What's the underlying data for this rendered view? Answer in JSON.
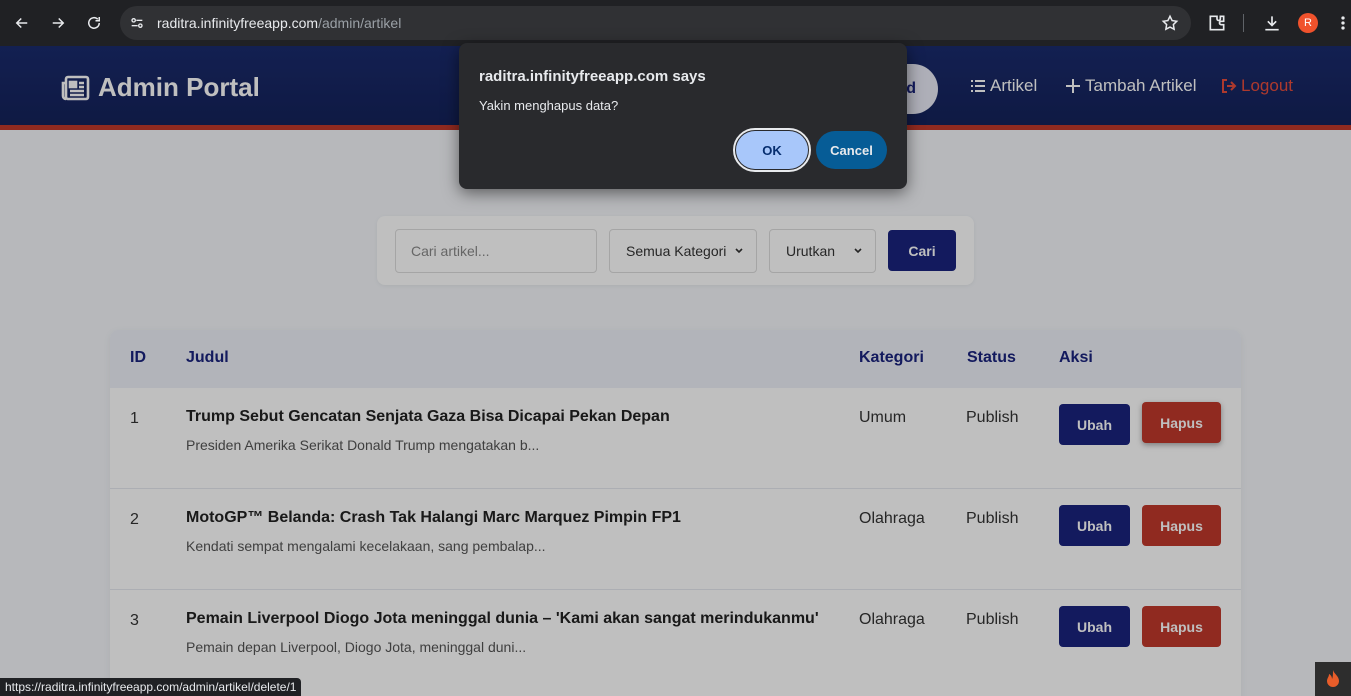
{
  "browser": {
    "url_host": "raditra.infinityfreeapp.com",
    "url_path": "/admin/artikel",
    "profile_initial": "R",
    "status_url": "https://raditra.infinityfreeapp.com/admin/artikel/delete/1"
  },
  "navbar": {
    "brand": "Admin Portal",
    "dashboard_partial": "d",
    "links": {
      "artikel": "Artikel",
      "tambah": "Tambah Artikel",
      "logout": "Logout"
    }
  },
  "search": {
    "placeholder": "Cari artikel...",
    "category_select": "Semua Kategori",
    "sort_select": "Urutkan",
    "button": "Cari"
  },
  "table": {
    "headers": {
      "id": "ID",
      "judul": "Judul",
      "kategori": "Kategori",
      "status": "Status",
      "aksi": "Aksi"
    },
    "edit_label": "Ubah",
    "delete_label": "Hapus",
    "rows": [
      {
        "id": "1",
        "title": "Trump Sebut Gencatan Senjata Gaza Bisa Dicapai Pekan Depan",
        "excerpt": "Presiden Amerika Serikat Donald Trump mengatakan b...",
        "category": "Umum",
        "status": "Publish"
      },
      {
        "id": "2",
        "title": "MotoGP™ Belanda: Crash Tak Halangi Marc Marquez Pimpin FP1",
        "excerpt": "Kendati sempat mengalami kecelakaan, sang pembalap...",
        "category": "Olahraga",
        "status": "Publish"
      },
      {
        "id": "3",
        "title": "Pemain Liverpool Diogo Jota meninggal dunia – 'Kami akan sangat merindukanmu'",
        "excerpt": "Pemain depan Liverpool, Diogo Jota, meninggal duni...",
        "category": "Olahraga",
        "status": "Publish"
      }
    ]
  },
  "dialog": {
    "title": "raditra.infinityfreeapp.com says",
    "message": "Yakin menghapus data?",
    "ok": "OK",
    "cancel": "Cancel"
  },
  "colors": {
    "primary": "#1a237e",
    "danger": "#c0392b",
    "navbar": "#14225a"
  }
}
